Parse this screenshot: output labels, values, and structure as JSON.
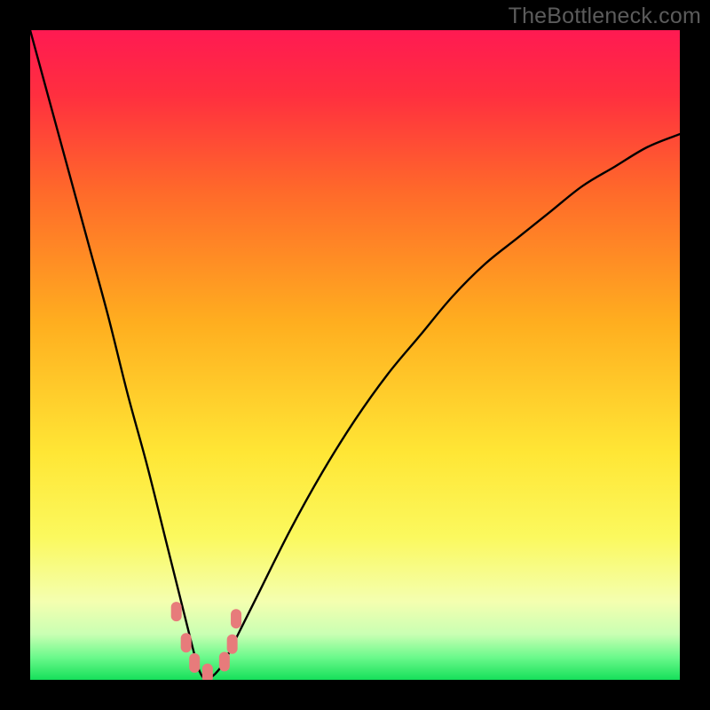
{
  "watermark": "TheBottleneck.com",
  "colors": {
    "frame": "#000000",
    "curve": "#000000",
    "marker_fill": "#e77b7b",
    "marker_stroke": "#d86767",
    "gradient_stops": [
      {
        "offset": 0.0,
        "color": "#ff1a52"
      },
      {
        "offset": 0.1,
        "color": "#ff2f3f"
      },
      {
        "offset": 0.25,
        "color": "#ff6a2a"
      },
      {
        "offset": 0.45,
        "color": "#ffae1f"
      },
      {
        "offset": 0.65,
        "color": "#ffe635"
      },
      {
        "offset": 0.78,
        "color": "#fbf95e"
      },
      {
        "offset": 0.88,
        "color": "#f4ffb0"
      },
      {
        "offset": 0.93,
        "color": "#c9ffb3"
      },
      {
        "offset": 0.965,
        "color": "#6cf98c"
      },
      {
        "offset": 1.0,
        "color": "#16e05a"
      }
    ]
  },
  "chart_data": {
    "type": "line",
    "title": "",
    "xlabel": "",
    "ylabel": "",
    "xlim": [
      0,
      100
    ],
    "ylim": [
      0,
      100
    ],
    "grid": false,
    "legend": false,
    "description": "Bottleneck-style V-curve: value drops sharply to ~0 near x≈27 then rises with decreasing slope toward x=100. Background is a vertical red→green gradient (red=high/bad at top, green=low/good at bottom).",
    "series": [
      {
        "name": "bottleneck-curve",
        "x": [
          0,
          3,
          6,
          9,
          12,
          15,
          18,
          21,
          23,
          25,
          26,
          27,
          28,
          29,
          30,
          32,
          35,
          40,
          45,
          50,
          55,
          60,
          65,
          70,
          75,
          80,
          85,
          90,
          95,
          100
        ],
        "y": [
          100,
          89,
          78,
          67,
          56,
          44,
          33,
          21,
          13,
          5,
          1.5,
          0,
          0.5,
          1.5,
          3,
          7,
          13,
          23,
          32,
          40,
          47,
          53,
          59,
          64,
          68,
          72,
          76,
          79,
          82,
          84
        ]
      }
    ],
    "markers": [
      {
        "x": 22.5,
        "y": 10.5
      },
      {
        "x": 24.0,
        "y": 5.7
      },
      {
        "x": 25.3,
        "y": 2.6
      },
      {
        "x": 27.3,
        "y": 1.0
      },
      {
        "x": 29.9,
        "y": 2.8
      },
      {
        "x": 31.1,
        "y": 5.5
      },
      {
        "x": 31.7,
        "y": 9.4
      }
    ]
  }
}
